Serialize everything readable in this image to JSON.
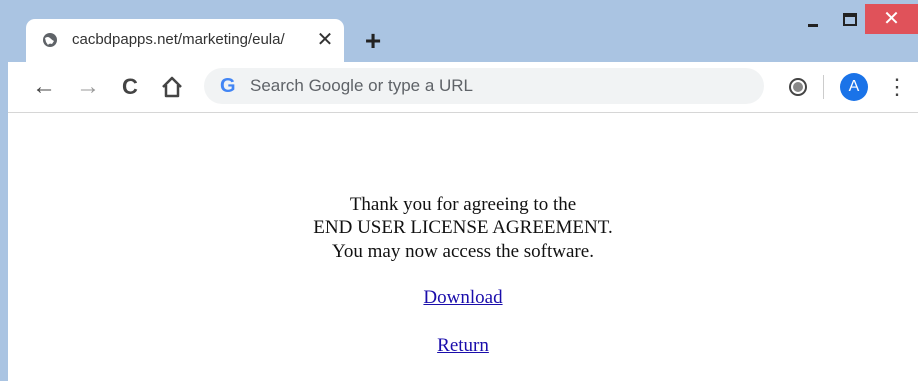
{
  "browser": {
    "tab": {
      "title": "cacbdpapps.net/marketing/eula/",
      "close_glyph": "✕",
      "favicon": "globe-icon"
    },
    "new_tab_glyph": "+",
    "window_controls": {
      "close_glyph": "✕"
    },
    "toolbar": {
      "back_glyph": "←",
      "forward_glyph": "→",
      "reload_glyph": "C",
      "home_icon": "home-icon",
      "search_placeholder": "Search Google or type a URL",
      "google_glyph": "G",
      "avatar_letter": "A",
      "menu_glyph": "⋮"
    }
  },
  "page": {
    "lines": [
      "Thank you for agreeing to the",
      "END USER LICENSE AGREEMENT.",
      "You may now access the software."
    ],
    "download_link": "Download",
    "return_link": "Return"
  },
  "colors": {
    "titlebar": "#aac4e2",
    "close_button": "#e0525a",
    "avatar": "#1a73e8",
    "link": "#1a0dab"
  }
}
